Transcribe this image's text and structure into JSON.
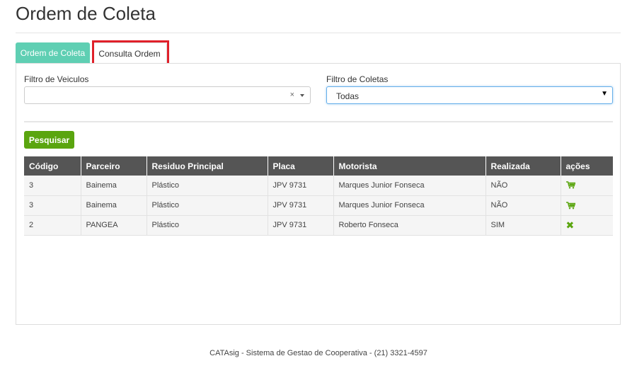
{
  "page_title": "Ordem de Coleta",
  "tabs": [
    {
      "label": "Ordem de Coleta",
      "active": true
    },
    {
      "label": "Consulta Ordem",
      "active": false
    }
  ],
  "filters": {
    "vehicles_label": "Filtro de Veiculos",
    "vehicles_value": "",
    "vehicles_clear": "×",
    "coletas_label": "Filtro de Coletas",
    "coletas_value": "Todas",
    "coletas_caret": "▼"
  },
  "search_button": "Pesquisar",
  "table": {
    "headers": [
      "Código",
      "Parceiro",
      "Residuo Principal",
      "Placa",
      "Motorista",
      "Realizada",
      "ações"
    ],
    "rows": [
      {
        "codigo": "3",
        "parceiro": "Bainema",
        "residuo": "Plástico",
        "placa": "JPV 9731",
        "motorista": "Marques Junior Fonseca",
        "realizada": "NÃO",
        "action_icon": "cart-icon"
      },
      {
        "codigo": "3",
        "parceiro": "Bainema",
        "residuo": "Plástico",
        "placa": "JPV 9731",
        "motorista": "Marques Junior Fonseca",
        "realizada": "NÃO",
        "action_icon": "cart-icon"
      },
      {
        "codigo": "2",
        "parceiro": "PANGEA",
        "residuo": "Plástico",
        "placa": "JPV 9731",
        "motorista": "Roberto Fonseca",
        "realizada": "SIM",
        "action_icon": "close-icon",
        "action_glyph": "✖"
      }
    ]
  },
  "footer": "CATAsig - Sistema de Gestao de Cooperativa - (21) 3321-4597",
  "colors": {
    "tab_active": "#5fcfb3",
    "search_button": "#5aa50f",
    "table_header": "#555555",
    "highlight": "#e0202a",
    "action_icon": "#5aa50f"
  }
}
